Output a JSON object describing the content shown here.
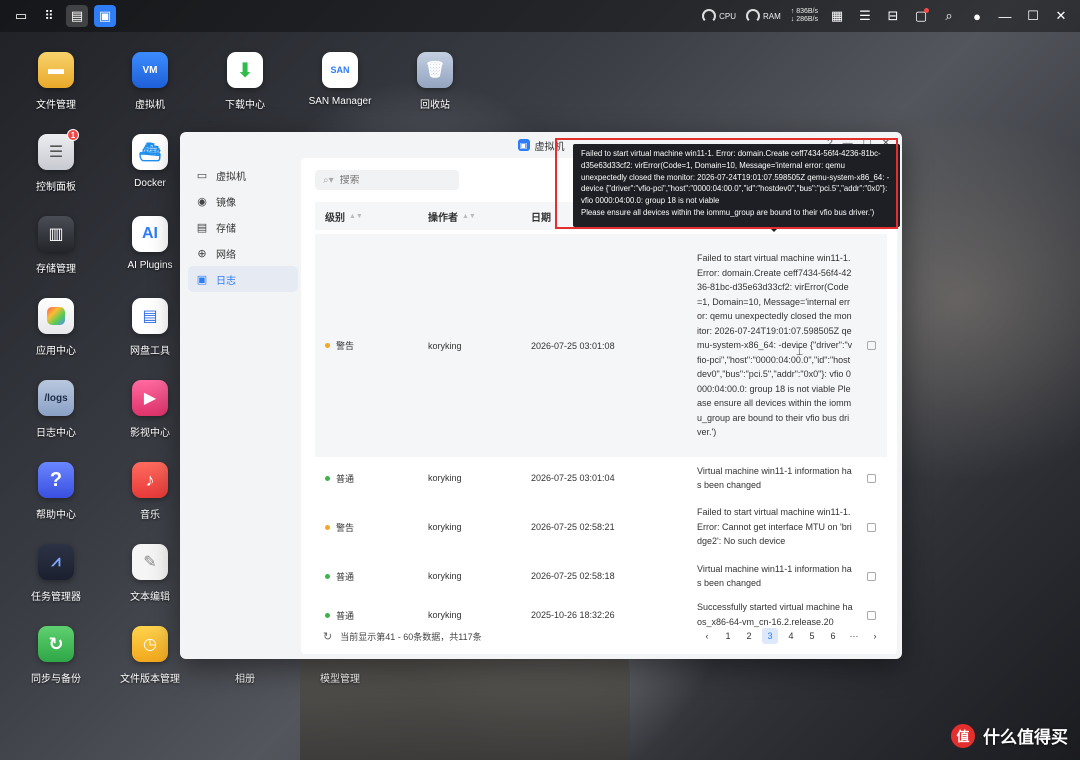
{
  "topbar": {
    "left_icons": [
      "desktop-icon",
      "apps-grid-icon",
      "task-switch-icon",
      "vm-app-icon"
    ],
    "cpu_label": "CPU",
    "ram_label": "RAM",
    "net_up": "↑ 836B/s",
    "net_down": "↓ 286B/s"
  },
  "desktop": {
    "col1": [
      "文件管理",
      "控制面板",
      "存储管理",
      "应用中心",
      "日志中心",
      "帮助中心",
      "任务管理器",
      "同步与备份"
    ],
    "col2": [
      "虚拟机",
      "Docker",
      "AI Plugins",
      "网盘工具",
      "影视中心",
      "音乐",
      "文本编辑",
      "文件版本管理"
    ],
    "row1_extra": [
      "下载中心",
      "SAN Manager",
      "回收站"
    ],
    "bottom_extra": [
      "相册",
      "模型管理"
    ],
    "control_panel_badge": "1",
    "logs_icon_text": "/logs",
    "ai_icon_text": "AI",
    "vm_icon_text": "VM",
    "san_icon_text": "SAN"
  },
  "window": {
    "title": "虚拟机",
    "sidebar": [
      "虚拟机",
      "镜像",
      "存储",
      "网络",
      "日志"
    ],
    "search_placeholder": "搜索",
    "columns": {
      "level": "级别",
      "operator": "操作者",
      "date": "日期"
    },
    "rows": [
      {
        "level": "警告",
        "operator": "koryking",
        "date": "2026-07-25 03:01:08",
        "message": "Failed to start virtual machine win11-1. Error: domain.Create ceff7434-56f4-4236-81bc-d35e63d33cf2: virError(Code=1, Domain=10, Message='internal error: qemu unexpectedly closed the monitor: 2026-07-24T19:01:07.598505Z qemu-system-x86_64: -device {\"driver\":\"vfio-pci\",\"host\":\"0000:04:00.0\",\"id\":\"hostdev0\",\"bus\":\"pci.5\",\"addr\":\"0x0\"}: vfio 0000:04:00.0: group 18 is not viable Please ensure all devices within the iommu_group are bound to their vfio bus driver.')"
      },
      {
        "level": "普通",
        "operator": "koryking",
        "date": "2026-07-25 03:01:04",
        "message": "Virtual machine win11-1 information has been changed"
      },
      {
        "level": "警告",
        "operator": "koryking",
        "date": "2026-07-25 02:58:21",
        "message": "Failed to start virtual machine win11-1. Error: Cannot get interface MTU on 'bridge2': No such device"
      },
      {
        "level": "普通",
        "operator": "koryking",
        "date": "2026-07-25 02:58:18",
        "message": "Virtual machine win11-1 information has been changed"
      },
      {
        "level": "普通",
        "operator": "koryking",
        "date": "2025-10-26 18:32:26",
        "message": "Successfully started virtual machine haos_x86-64-vm_cn-16.2.release.20"
      }
    ],
    "footer_status": "当前显示第41 - 60条数据，共117条",
    "pages": [
      "1",
      "2",
      "3",
      "4",
      "5",
      "6",
      "···"
    ],
    "current_page": "3"
  },
  "tooltip": {
    "lines": [
      "Failed to start virtual machine win11-1. Error: domain.Create ceff7434-56f4-4236-81bc-",
      "d35e63d33cf2: virError(Code=1, Domain=10, Message='internal error: qemu",
      "unexpectedly closed the monitor: 2026-07-24T19:01:07.598505Z qemu-system-x86_64: -",
      "device {\"driver\":\"vfio-pci\",\"host\":\"0000:04:00.0\",\"id\":\"hostdev0\",\"bus\":\"pci.5\",\"addr\":\"0x0\"}:",
      "vfio 0000:04:00.0: group 18 is not viable",
      "Please ensure all devices within the iommu_group are bound to their vfio bus driver.')"
    ]
  },
  "watermark": {
    "logo": "值",
    "text": "什么值得买"
  },
  "colors": {
    "accent": "#2e7cf6",
    "warn": "#f5a623",
    "ok": "#3bb54a",
    "highlight_frame": "#e52e2e"
  }
}
